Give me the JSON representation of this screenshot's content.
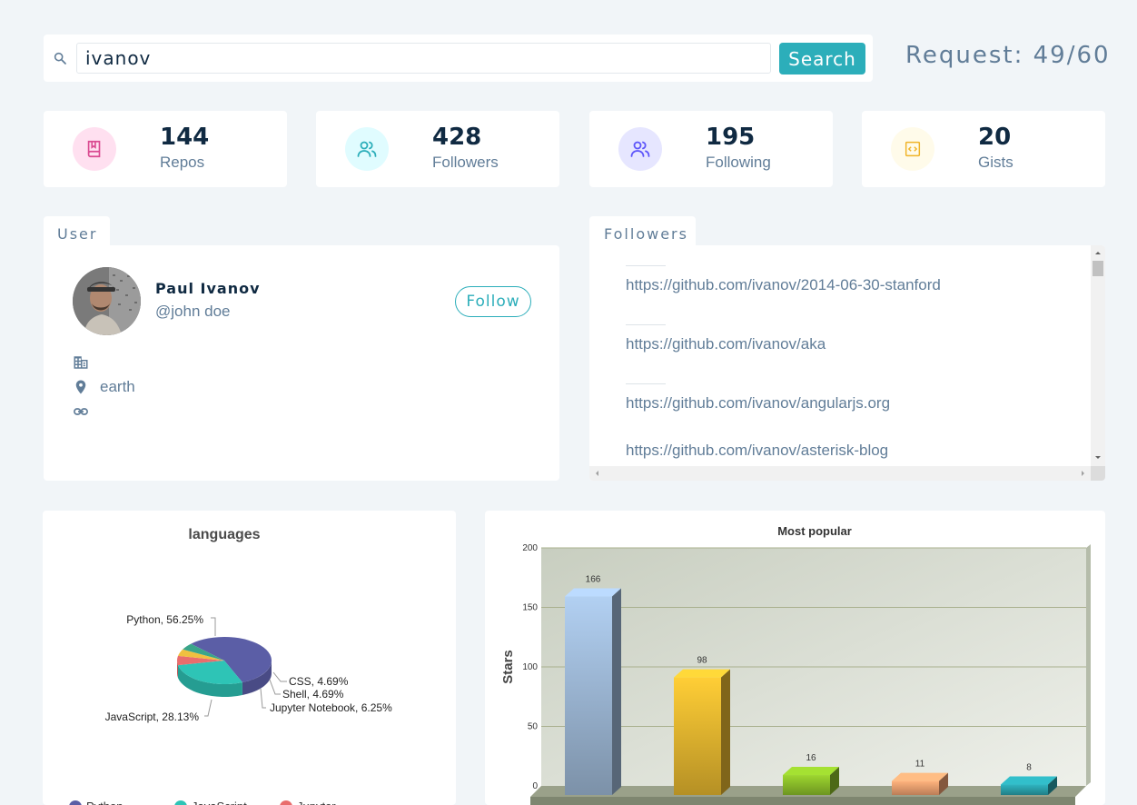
{
  "search": {
    "value": "ivanov",
    "button_label": "Search"
  },
  "request": {
    "label": "Request: 49/60"
  },
  "stats": [
    {
      "value": "144",
      "label": "Repos",
      "icon": "book-icon",
      "color": "#da4a91",
      "bg": "#ffe0f0"
    },
    {
      "value": "428",
      "label": "Followers",
      "icon": "users-icon",
      "color": "#2caeba",
      "bg": "#e0fcff"
    },
    {
      "value": "195",
      "label": "Following",
      "icon": "user-plus-icon",
      "color": "#5d55fa",
      "bg": "#e6e6ff"
    },
    {
      "value": "20",
      "label": "Gists",
      "icon": "code-icon",
      "color": "#f0b429",
      "bg": "#fffbea"
    }
  ],
  "user": {
    "tab_label": "User",
    "name": "Paul Ivanov",
    "login": "@john doe",
    "follow_label": "Follow",
    "company": "",
    "location": "earth",
    "blog": ""
  },
  "followers": {
    "tab_label": "Followers",
    "items": [
      "https://github.com/ivanov/2014-06-30-stanford",
      "https://github.com/ivanov/aka",
      "https://github.com/ivanov/angularjs.org",
      "https://github.com/ivanov/asterisk-blog"
    ]
  },
  "languages_chart": {
    "title": "languages",
    "legend": [
      "Python",
      "JavaScript",
      "Jupyter"
    ]
  },
  "popular_chart": {
    "title": "Most popular",
    "ylabel": "Stars"
  },
  "chart_data": [
    {
      "type": "pie",
      "title": "languages",
      "labels": [
        "Python",
        "JavaScript",
        "Jupyter Notebook",
        "Shell",
        "CSS"
      ],
      "values": [
        56.25,
        28.13,
        6.25,
        4.69,
        4.69
      ],
      "data_labels": [
        "Python, 56.25%",
        "JavaScript, 28.13%",
        "Jupyter Notebook, 6.25%",
        "Shell, 4.69%",
        "CSS, 4.69%"
      ],
      "colors": [
        "#5b5ea6",
        "#2ec4b6",
        "#e96d6d",
        "#f0c040",
        "#3aa58a"
      ],
      "legend_placement": "bottom"
    },
    {
      "type": "bar",
      "title": "Most popular",
      "ylabel": "Stars",
      "xlabel": "",
      "categories": [
        "",
        "",
        "",
        "",
        ""
      ],
      "values": [
        166,
        98,
        16,
        11,
        8
      ],
      "ylim": [
        0,
        200
      ],
      "yticks": [
        0,
        50,
        100,
        150,
        200
      ],
      "colors": [
        "#9fbad8",
        "#e8b830",
        "#8cbf2a",
        "#f0a070",
        "#2aa2ac"
      ],
      "grid": true
    }
  ]
}
